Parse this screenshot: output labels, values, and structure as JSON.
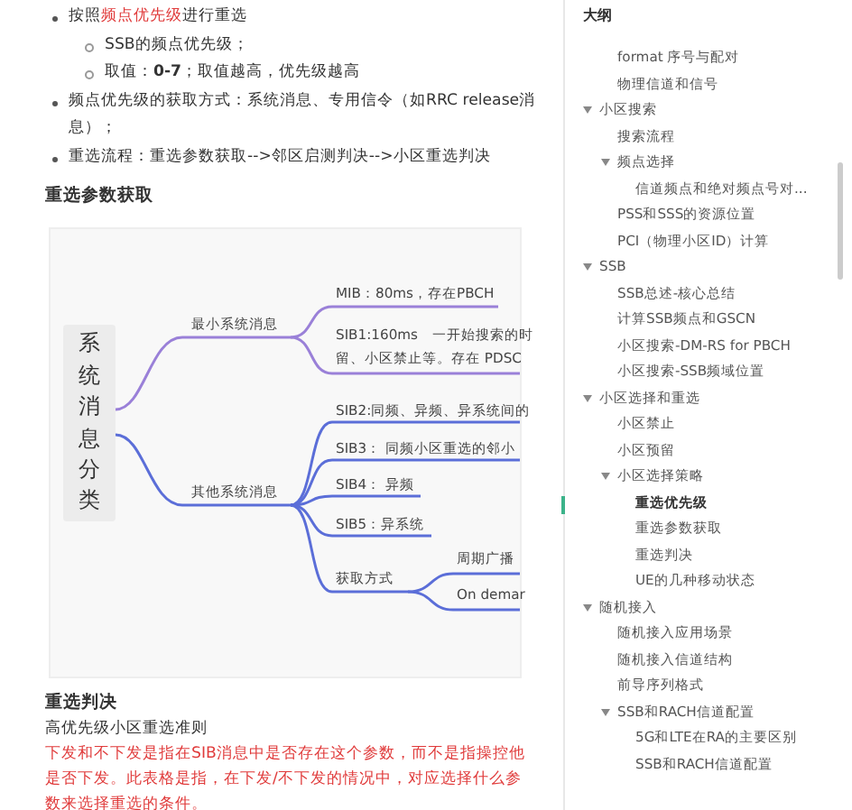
{
  "article": {
    "bullets": [
      {
        "segments": [
          {
            "text": "按照",
            "kind": "plain"
          },
          {
            "text": "频点优先级",
            "kind": "red"
          },
          {
            "text": "进行重选",
            "kind": "plain"
          }
        ],
        "children": [
          {
            "text": "SSB的频点优先级；"
          },
          {
            "text": "取值：**0-7**；取值越高，优先级越高"
          }
        ]
      },
      {
        "segments": [
          {
            "text": "频点优先级的获取方式：系统消息、专用信令（如RRC release消息）；",
            "kind": "plain"
          }
        ]
      },
      {
        "segments": [
          {
            "text": "重选流程：重选参数获取-->邻区启测判决-->小区重选判决",
            "kind": "plain"
          }
        ]
      }
    ],
    "heading_1": "重选参数获取",
    "mindmap": {
      "root": "系统消息分类",
      "branches": [
        {
          "label": "最小系统消息",
          "color": "#9a80d8",
          "leaves": [
            {
              "lines": [
                "MIB：80ms，存在PBCH"
              ]
            },
            {
              "lines": [
                "SIB1:160ms　一开始搜索的时",
                "留、小区禁止等。存在 PDSC"
              ]
            }
          ]
        },
        {
          "label": "其他系统消息",
          "color": "#5b6ed8",
          "leaves": [
            {
              "lines": [
                "SIB2:同频、异频、异系统间的"
              ]
            },
            {
              "lines": [
                "SIB3： 同频小区重选的邻小"
              ]
            },
            {
              "lines": [
                "SIB4： 异频"
              ]
            },
            {
              "lines": [
                "SIB5：异系统"
              ]
            },
            {
              "lines": [
                "获取方式"
              ],
              "leaves": [
                {
                  "lines": [
                    "周期广播"
                  ]
                },
                {
                  "lines": [
                    "On demar"
                  ]
                }
              ]
            }
          ]
        }
      ]
    },
    "heading_2": "重选判决",
    "paragraph": "高优先级小区重选准则",
    "note": "下发和不下发是指在SIB消息中是否存在这个参数，而不是指操控他是否下发。此表格是指，在下发/不下发的情况中，对应选择什么参数来选择重选的条件。"
  },
  "outline": {
    "title": "大纲",
    "orphan_items": [
      {
        "label": "format 序号与配对",
        "selected": false
      },
      {
        "label": "物理信道和信号",
        "selected": false
      }
    ],
    "items": [
      {
        "label": "小区搜索",
        "selected": false,
        "expanded": true,
        "children": [
          {
            "label": "搜索流程",
            "selected": false
          },
          {
            "label": "频点选择",
            "selected": false,
            "expanded": true,
            "children": [
              {
                "label": "信道频点和绝对频点号对...",
                "selected": false
              }
            ]
          },
          {
            "label": "PSS和SSS的资源位置",
            "selected": false
          },
          {
            "label": "PCI（物理小区ID）计算",
            "selected": false
          }
        ]
      },
      {
        "label": "SSB",
        "selected": false,
        "expanded": true,
        "children": [
          {
            "label": "SSB总述-核心总结",
            "selected": false
          },
          {
            "label": "计算SSB频点和GSCN",
            "selected": false
          },
          {
            "label": "小区搜索-DM-RS for PBCH",
            "selected": false
          },
          {
            "label": "小区搜索-SSB频域位置",
            "selected": false
          }
        ]
      },
      {
        "label": "小区选择和重选",
        "selected": false,
        "expanded": true,
        "children": [
          {
            "label": "小区禁止",
            "selected": false
          },
          {
            "label": "小区预留",
            "selected": false
          },
          {
            "label": "小区选择策略",
            "selected": false,
            "expanded": true,
            "children": [
              {
                "label": "重选优先级",
                "selected": true
              },
              {
                "label": "重选参数获取",
                "selected": false
              },
              {
                "label": "重选判决",
                "selected": false
              },
              {
                "label": "UE的几种移动状态",
                "selected": false
              }
            ]
          }
        ]
      },
      {
        "label": "随机接入",
        "selected": false,
        "expanded": true,
        "children": [
          {
            "label": "随机接入应用场景",
            "selected": false
          },
          {
            "label": "随机接入信道结构",
            "selected": false
          },
          {
            "label": "前导序列格式",
            "selected": false
          },
          {
            "label": "SSB和RACH信道配置",
            "selected": false,
            "expanded": true,
            "children": [
              {
                "label": "5G和LTE在RA的主要区别",
                "selected": false
              },
              {
                "label": "SSB和RACH信道配置",
                "selected": false
              }
            ]
          }
        ]
      }
    ]
  }
}
